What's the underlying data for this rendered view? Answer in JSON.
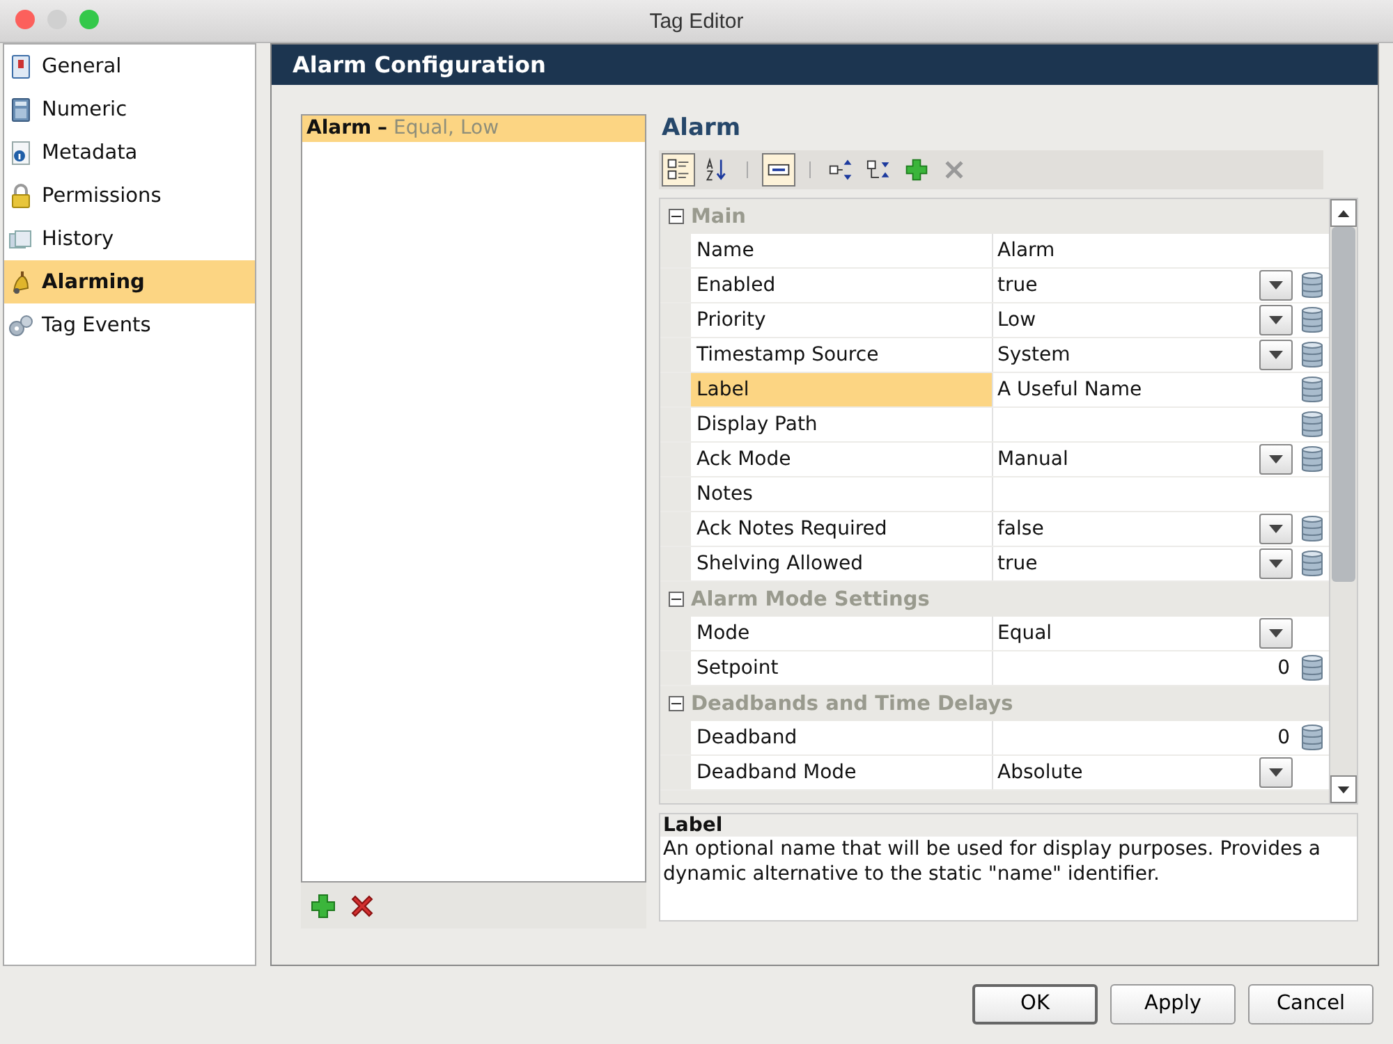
{
  "window": {
    "title": "Tag Editor"
  },
  "sidebar": {
    "items": [
      {
        "label": "General",
        "selected": false
      },
      {
        "label": "Numeric",
        "selected": false
      },
      {
        "label": "Metadata",
        "selected": false
      },
      {
        "label": "Permissions",
        "selected": false
      },
      {
        "label": "History",
        "selected": false
      },
      {
        "label": "Alarming",
        "selected": true
      },
      {
        "label": "Tag Events",
        "selected": false
      }
    ]
  },
  "panel": {
    "title": "Alarm Configuration",
    "alarms": [
      {
        "name": "Alarm",
        "separator": "–",
        "summary": "Equal, Low",
        "selected": true
      }
    ],
    "editor": {
      "title": "Alarm",
      "toolbar": [
        {
          "kind": "button",
          "selected": true
        },
        {
          "kind": "button",
          "selected": false
        },
        {
          "kind": "sep"
        },
        {
          "kind": "button",
          "selected": true
        },
        {
          "kind": "sep"
        },
        {
          "kind": "button",
          "selected": false
        },
        {
          "kind": "button",
          "selected": false
        },
        {
          "kind": "button",
          "selected": false
        },
        {
          "kind": "button",
          "selected": false
        }
      ],
      "rows": [
        {
          "kind": "section",
          "label": "Main",
          "expanded": true
        },
        {
          "kind": "property",
          "name": "Name",
          "value": "Alarm",
          "dropdown": false,
          "bindable": false,
          "selected": false
        },
        {
          "kind": "property",
          "name": "Enabled",
          "value": "true",
          "dropdown": true,
          "bindable": true,
          "selected": false
        },
        {
          "kind": "property",
          "name": "Priority",
          "value": "Low",
          "dropdown": true,
          "bindable": true,
          "selected": false
        },
        {
          "kind": "property",
          "name": "Timestamp Source",
          "value": "System",
          "dropdown": true,
          "bindable": true,
          "selected": false
        },
        {
          "kind": "property",
          "name": "Label",
          "value": "A Useful Name",
          "dropdown": false,
          "bindable": true,
          "selected": true
        },
        {
          "kind": "property",
          "name": "Display Path",
          "dropdown": false,
          "bindable": true,
          "selected": false
        },
        {
          "kind": "property",
          "name": "Ack Mode",
          "value": "Manual",
          "dropdown": true,
          "bindable": true,
          "selected": false
        },
        {
          "kind": "property",
          "name": "Notes",
          "dropdown": false,
          "bindable": false,
          "selected": false
        },
        {
          "kind": "property",
          "name": "Ack Notes Required",
          "value": "false",
          "dropdown": true,
          "bindable": true,
          "selected": false
        },
        {
          "kind": "property",
          "name": "Shelving Allowed",
          "value": "true",
          "dropdown": true,
          "bindable": true,
          "selected": false
        },
        {
          "kind": "section",
          "label": "Alarm Mode Settings",
          "expanded": true
        },
        {
          "kind": "property",
          "name": "Mode",
          "value": "Equal",
          "dropdown": true,
          "bindable": false,
          "selected": false
        },
        {
          "kind": "number",
          "name": "Setpoint",
          "value": "0",
          "dropdown": false,
          "bindable": true,
          "selected": false
        },
        {
          "kind": "section",
          "label": "Deadbands and Time Delays",
          "expanded": true
        },
        {
          "kind": "number",
          "name": "Deadband",
          "value": "0",
          "dropdown": false,
          "bindable": true,
          "selected": false
        },
        {
          "kind": "property",
          "name": "Deadband Mode",
          "value": "Absolute",
          "dropdown": true,
          "bindable": false,
          "selected": false
        }
      ],
      "description": {
        "title": "Label",
        "text": "An optional name that will be used for display purposes. Provides a dynamic alternative to the static \"name\" identifier."
      }
    }
  },
  "buttons": [
    {
      "label": "OK",
      "default": true
    },
    {
      "label": "Apply",
      "default": false
    },
    {
      "label": "Cancel",
      "default": false
    }
  ]
}
